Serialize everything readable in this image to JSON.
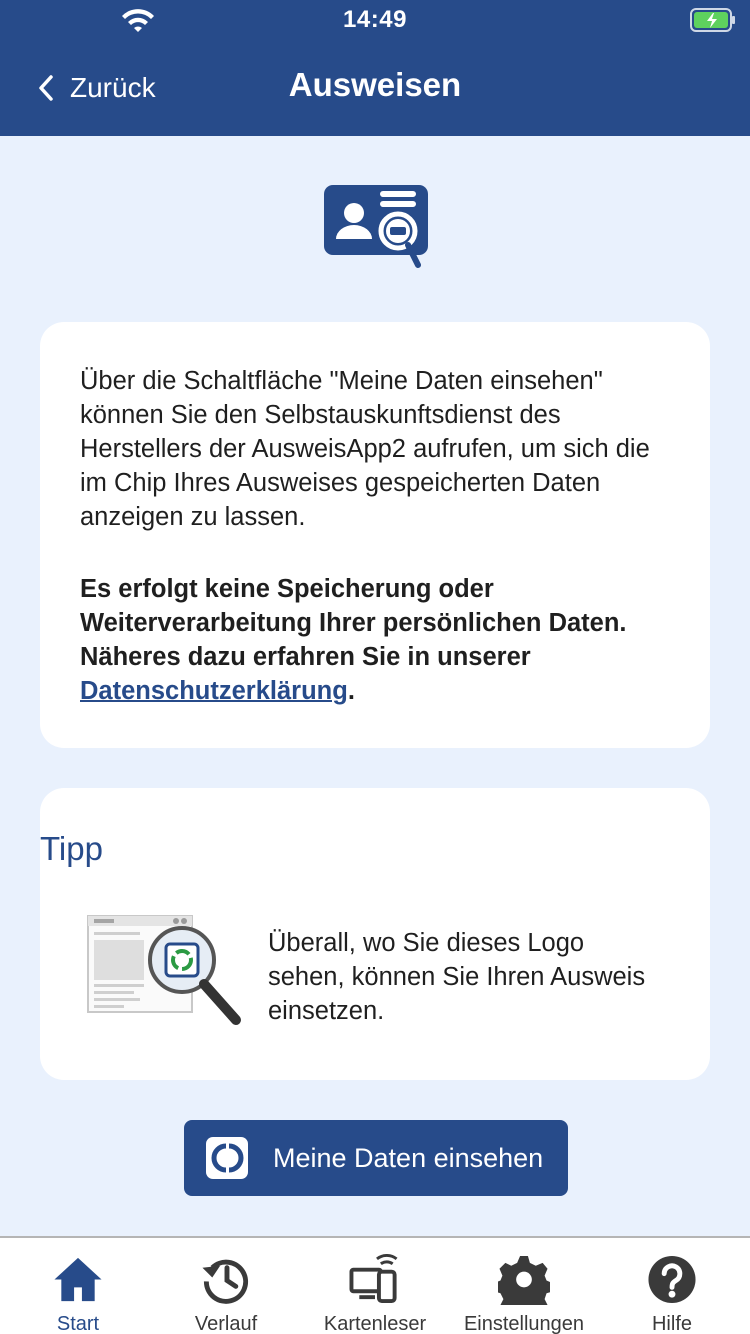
{
  "status_bar": {
    "time": "14:49"
  },
  "header": {
    "back_label": "Zurück",
    "title": "Ausweisen"
  },
  "info_card": {
    "paragraph": "Über die Schaltfläche \"Meine Daten einsehen\" können Sie den Selbstauskunftsdienst des Herstellers der AusweisApp2 aufrufen, um sich die im Chip Ihres Ausweises gespeicherten Daten anzeigen zu lassen.",
    "bold_text": "Es erfolgt keine Speicherung oder Weiterverarbeitung Ihrer persönlichen Daten. Näheres dazu erfahren Sie in unserer ",
    "privacy_link": "Datenschutzerklärung",
    "bold_end": "."
  },
  "tip_card": {
    "title": "Tipp",
    "text": "Überall, wo Sie dieses Logo sehen, können Sie Ihren Ausweis einsetzen."
  },
  "primary_button": {
    "label": "Meine Daten einsehen"
  },
  "tabs": [
    {
      "label": "Start",
      "icon": "home-icon"
    },
    {
      "label": "Verlauf",
      "icon": "history-icon"
    },
    {
      "label": "Kartenleser",
      "icon": "card-reader-icon"
    },
    {
      "label": "Einstellungen",
      "icon": "gear-icon"
    },
    {
      "label": "Hilfe",
      "icon": "help-icon"
    }
  ],
  "colors": {
    "brand": "#274b8a",
    "background": "#e9f1fd",
    "battery": "#5ed15e"
  }
}
